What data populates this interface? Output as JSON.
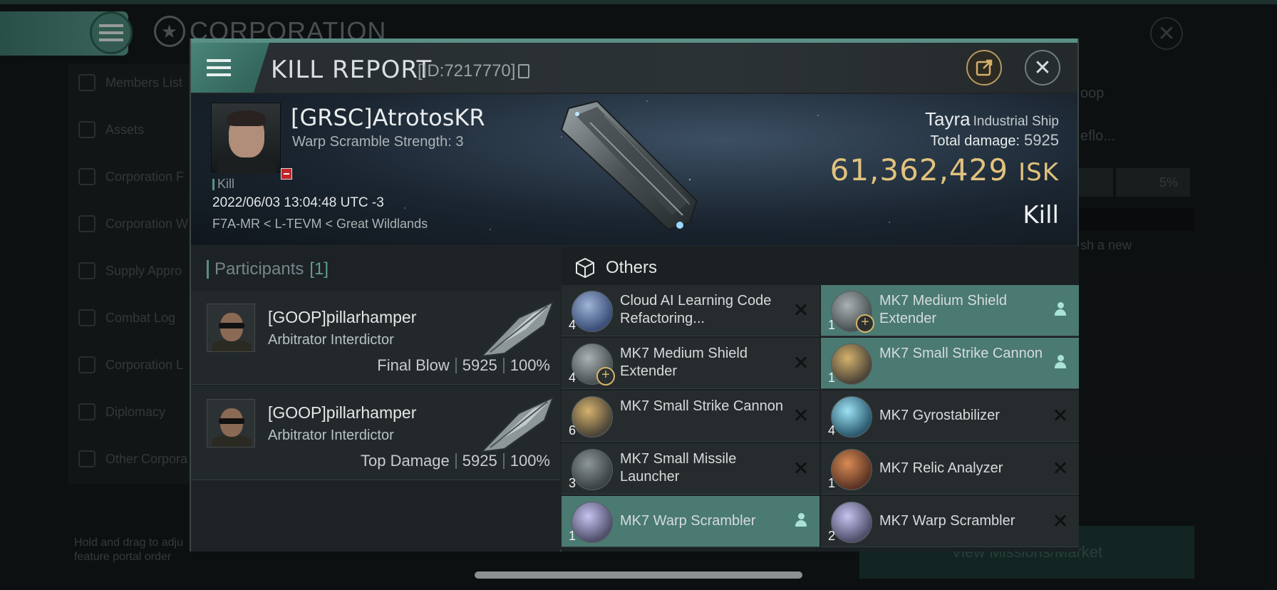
{
  "background": {
    "title": "CORPORATION",
    "sidebar": [
      "Members List",
      "Assets",
      "Corporation F",
      "Corporation W",
      "Supply Appro",
      "Combat Log",
      "Corporation L",
      "Diplomacy",
      "Other Corpora"
    ],
    "hint": "Hold and drag to adju feature portal order",
    "right_snippets": {
      "goop": "oop",
      "reflo": "eflo...",
      "percent": "5%",
      "new": "sh a new",
      "view_button": "View Missions/Market"
    }
  },
  "modal": {
    "title": "KILL REPORT",
    "id_label": "[ID:7217770]"
  },
  "victim": {
    "name": "[GRSC]AtrotosKR",
    "subtitle": "Warp Scramble Strength: 3",
    "tag": "Kill",
    "datetime": "2022/06/03 13:04:48 UTC -3",
    "location": "F7A-MR < L-TEVM < Great Wildlands",
    "ship_name": "Tayra",
    "ship_class": "Industrial Ship",
    "total_damage_label": "Total damage:",
    "total_damage": "5925",
    "isk_value": "61,362,429",
    "isk_unit": "ISK",
    "result": "Kill"
  },
  "participants": {
    "label": "Participants",
    "count": "[1]",
    "rows": [
      {
        "name": "[GOOP]pillarhamper",
        "ship": "Arbitrator Interdictor",
        "role": "Final Blow",
        "damage": "5925",
        "percent": "100%"
      },
      {
        "name": "[GOOP]pillarhamper",
        "ship": "Arbitrator Interdictor",
        "role": "Top Damage",
        "damage": "5925",
        "percent": "100%"
      }
    ]
  },
  "others": {
    "label": "Others",
    "items": [
      {
        "name": "Cloud AI Learning Code Refactoring...",
        "qty": "4",
        "fitted": false,
        "icon": "ai-chip-icon"
      },
      {
        "name": "MK7 Medium Shield Extender",
        "qty": "1",
        "fitted": true,
        "icon": "shield-extender-icon"
      },
      {
        "name": "MK7 Medium Shield Extender",
        "qty": "4",
        "fitted": false,
        "icon": "shield-extender-icon"
      },
      {
        "name": "MK7 Small Strike Cannon",
        "qty": "1",
        "fitted": true,
        "icon": "cannon-icon"
      },
      {
        "name": "MK7 Small Strike Cannon",
        "qty": "6",
        "fitted": false,
        "icon": "cannon-icon"
      },
      {
        "name": "MK7 Gyrostabilizer",
        "qty": "4",
        "fitted": false,
        "icon": "gyrostabilizer-icon"
      },
      {
        "name": "MK7 Small Missile Launcher",
        "qty": "3",
        "fitted": false,
        "icon": "missile-launcher-icon"
      },
      {
        "name": "MK7 Relic Analyzer",
        "qty": "1",
        "fitted": false,
        "icon": "relic-analyzer-icon"
      },
      {
        "name": "MK7 Warp Scrambler",
        "qty": "1",
        "fitted": true,
        "icon": "warp-scrambler-icon"
      },
      {
        "name": "MK7 Warp Scrambler",
        "qty": "2",
        "fitted": false,
        "icon": "warp-scrambler-icon"
      }
    ]
  },
  "colors": {
    "accent": "#5a8f86",
    "isk": "#e1c27d",
    "fitted_row": "#4a7a72"
  }
}
